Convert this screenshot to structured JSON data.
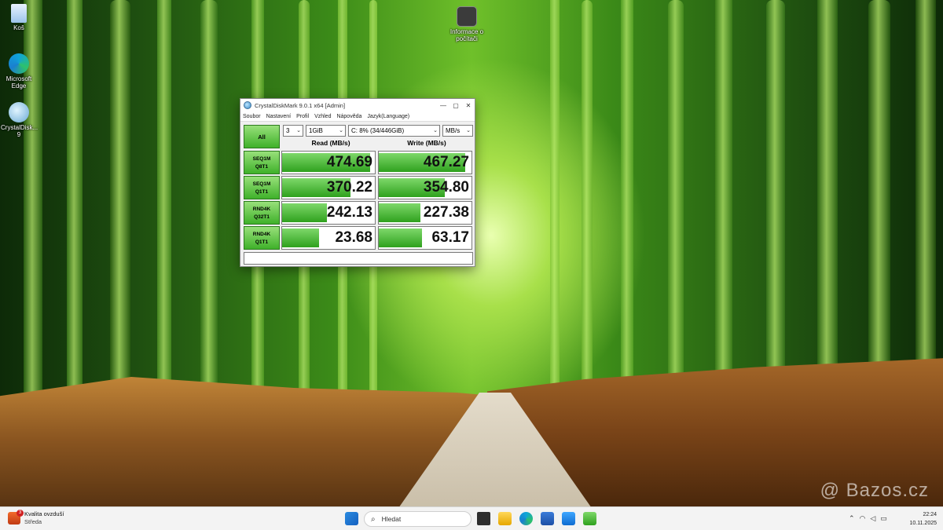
{
  "window": {
    "title": "CrystalDiskMark 9.0.1 x64 [Admin]",
    "controls": {
      "minimize": "—",
      "maximize": "▢",
      "close": "✕"
    }
  },
  "menu": [
    "Soubor",
    "Nastavení",
    "Profil",
    "Vzhled",
    "Nápověda",
    "Jazyk(Language)"
  ],
  "settings": {
    "all_label": "All",
    "count": "3",
    "size": "1GiB",
    "drive": "C: 8% (34/446GiB)",
    "unit": "MB/s"
  },
  "headers": {
    "read": "Read (MB/s)",
    "write": "Write (MB/s)"
  },
  "tests": [
    {
      "line1": "SEQ1M",
      "line2": "Q8T1",
      "read": "474.69",
      "write": "467.27",
      "read_fill": 0.95,
      "write_fill": 0.93
    },
    {
      "line1": "SEQ1M",
      "line2": "Q1T1",
      "read": "370.22",
      "write": "354.80",
      "read_fill": 0.74,
      "write_fill": 0.71
    },
    {
      "line1": "RND4K",
      "line2": "Q32T1",
      "read": "242.13",
      "write": "227.38",
      "read_fill": 0.48,
      "write_fill": 0.45
    },
    {
      "line1": "RND4K",
      "line2": "Q1T1",
      "read": "23.68",
      "write": "63.17",
      "read_fill": 0.4,
      "write_fill": 0.47
    }
  ],
  "desktop": {
    "recycle_label": "Koš",
    "edge_label": "Microsoft Edge",
    "cdm_label": "CrystalDisk... 9",
    "info_label": "Informace o počítači"
  },
  "taskbar": {
    "weather_title": "Kvalita ovzduší",
    "weather_value": "Středa",
    "weather_badge": "3",
    "search_placeholder": "Hledat",
    "time": "22:24",
    "date": "10.11.2025"
  },
  "watermark": "@ Bazos.cz"
}
